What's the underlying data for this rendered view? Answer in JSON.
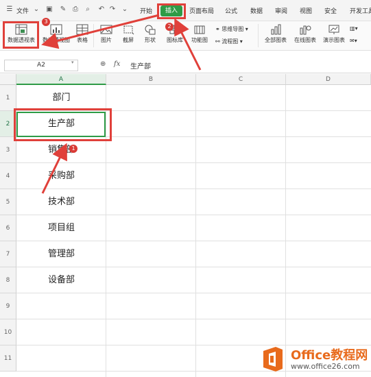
{
  "menubar": {
    "file_label": "文件",
    "tabs": [
      "开始",
      "插入",
      "页面布局",
      "公式",
      "数据",
      "审阅",
      "视图",
      "安全",
      "开发工具"
    ]
  },
  "ribbon": {
    "pivot_table": "数据透视表",
    "pivot_chart": "数据透视图",
    "table": "表格",
    "picture": "图片",
    "screenshot": "截屏",
    "shapes": "形状",
    "icon_lib": "图标库",
    "function_chart": "功能图",
    "mindmap": "思维导图",
    "flowchart": "流程图",
    "all_charts": "全部图表",
    "online_charts": "在线图表",
    "demo_charts": "演示图表"
  },
  "formula_bar": {
    "cell_ref": "A2",
    "fx": "fx",
    "value": "生产部"
  },
  "sheet": {
    "columns": [
      "A",
      "B",
      "C",
      "D"
    ],
    "rows": [
      "1",
      "2",
      "3",
      "4",
      "5",
      "6",
      "7",
      "8",
      "9",
      "10",
      "11"
    ],
    "cells": [
      "部门",
      "生产部",
      "销售部",
      "采购部",
      "技术部",
      "项目组",
      "管理部",
      "设备部"
    ]
  },
  "annotations": {
    "step1": "1",
    "step2": "2",
    "step3": "3",
    "color": "#e0403a"
  },
  "watermark": {
    "brand": "Office教程网",
    "url": "www.office26.com"
  },
  "colors": {
    "accent": "#2e9b46",
    "annotation": "#e0403a"
  }
}
